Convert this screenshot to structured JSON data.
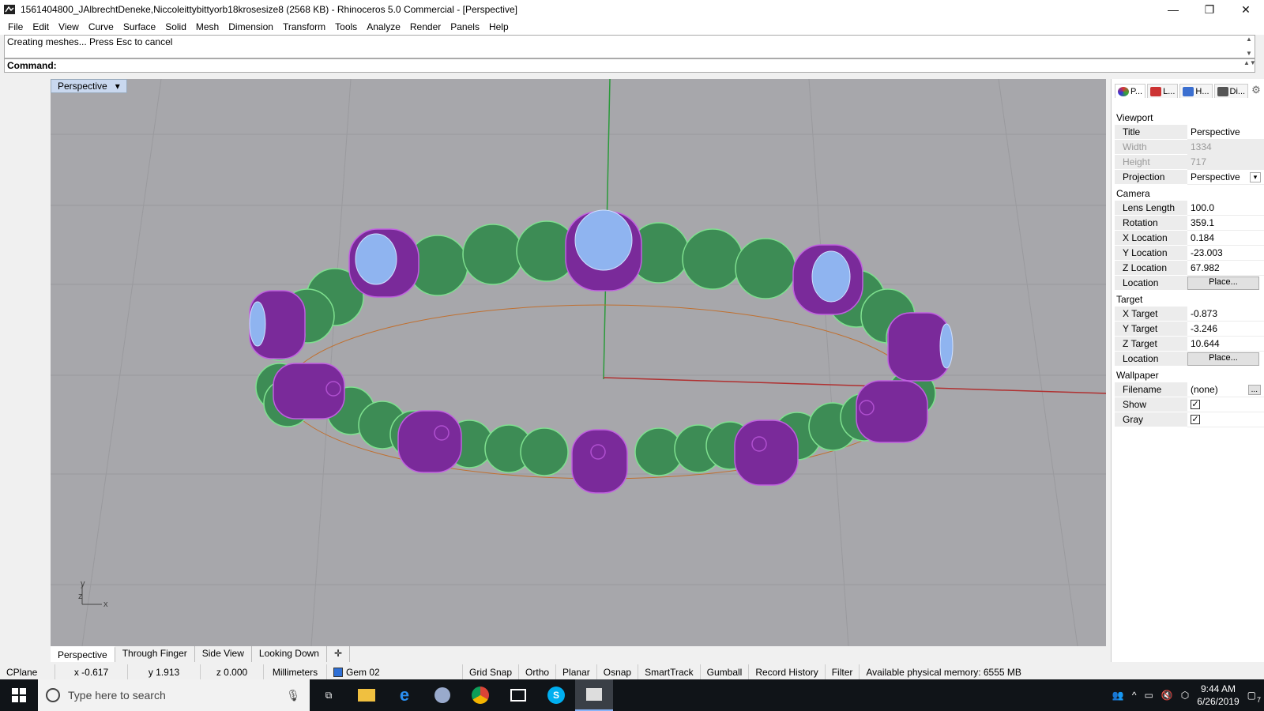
{
  "window": {
    "title": "1561404800_JAlbrechtDeneke,Niccoleittybittyorb18krosesize8 (2568 KB) - Rhinoceros 5.0 Commercial - [Perspective]",
    "minimize_glyph": "—",
    "maximize_glyph": "❐",
    "close_glyph": "✕"
  },
  "menu": [
    "File",
    "Edit",
    "View",
    "Curve",
    "Surface",
    "Solid",
    "Mesh",
    "Dimension",
    "Transform",
    "Tools",
    "Analyze",
    "Render",
    "Panels",
    "Help"
  ],
  "command": {
    "history": "Creating meshes... Press Esc to cancel",
    "prompt": "Command:",
    "value": ""
  },
  "viewport": {
    "label": "Perspective",
    "axis_x": "x",
    "axis_y": "y",
    "axis_z": "z",
    "colors": {
      "background": "#a7a7ab",
      "stone": "#3d8c55",
      "setting": "#7a2a9a",
      "gem": "#8fb4f0",
      "x_axis": "#b03030",
      "y_axis": "#2a9a3a"
    }
  },
  "viewport_tabs": [
    "Perspective",
    "Through Finger",
    "Side View",
    "Looking Down"
  ],
  "panel": {
    "tabs": [
      {
        "label": "P...",
        "icon": "properties-icon"
      },
      {
        "label": "L...",
        "icon": "layers-icon"
      },
      {
        "label": "H...",
        "icon": "help-icon"
      },
      {
        "label": "Di...",
        "icon": "display-icon"
      }
    ],
    "sections": {
      "viewport": "Viewport",
      "camera": "Camera",
      "target": "Target",
      "wallpaper": "Wallpaper"
    },
    "viewport_rows": {
      "title": {
        "key": "Title",
        "value": "Perspective"
      },
      "width": {
        "key": "Width",
        "value": "1334"
      },
      "height": {
        "key": "Height",
        "value": "717"
      },
      "projection": {
        "key": "Projection",
        "value": "Perspective"
      }
    },
    "camera_rows": {
      "lens": {
        "key": "Lens Length",
        "value": "100.0"
      },
      "rotation": {
        "key": "Rotation",
        "value": "359.1"
      },
      "xloc": {
        "key": "X Location",
        "value": "0.184"
      },
      "yloc": {
        "key": "Y Location",
        "value": "-23.003"
      },
      "zloc": {
        "key": "Z Location",
        "value": "67.982"
      },
      "location": {
        "key": "Location",
        "button": "Place..."
      }
    },
    "target_rows": {
      "x": {
        "key": "X Target",
        "value": "-0.873"
      },
      "y": {
        "key": "Y Target",
        "value": "-3.246"
      },
      "z": {
        "key": "Z Target",
        "value": "10.644"
      },
      "location": {
        "key": "Location",
        "button": "Place..."
      }
    },
    "wallpaper_rows": {
      "filename": {
        "key": "Filename",
        "value": "(none)",
        "button": "..."
      },
      "show": {
        "key": "Show",
        "checked": "✓"
      },
      "gray": {
        "key": "Gray",
        "checked": "✓"
      }
    }
  },
  "status": {
    "cplane": "CPlane",
    "x": "x -0.617",
    "y": "y 1.913",
    "z": "z 0.000",
    "units": "Millimeters",
    "layer": "Gem 02",
    "layer_color": "#2e6fd6",
    "grid_snap": "Grid Snap",
    "ortho": "Ortho",
    "planar": "Planar",
    "osnap": "Osnap",
    "smarttrack": "SmartTrack",
    "gumball": "Gumball",
    "record_history": "Record History",
    "filter": "Filter",
    "memory": "Available physical memory: 6555 MB"
  },
  "taskbar": {
    "search_placeholder": "Type here to search",
    "time": "9:44 AM",
    "date": "6/26/2019",
    "notifications": "7"
  }
}
